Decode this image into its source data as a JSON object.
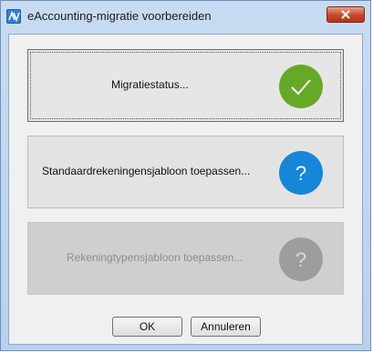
{
  "window": {
    "title": "eAccounting-migratie voorbereiden",
    "icon": "app-logo-icon",
    "close_icon": "close-icon"
  },
  "steps": [
    {
      "label": "Migratiestatus...",
      "status": "completed",
      "status_icon": "checkmark-icon",
      "status_color": "#66a926",
      "enabled": true
    },
    {
      "label": "Standaardrekeningensjabloon toepassen...",
      "status": "pending",
      "status_icon": "question-icon",
      "status_color": "#1586d8",
      "enabled": true
    },
    {
      "label": "Rekeningtypensjabloon toepassen...",
      "status": "pending",
      "status_icon": "question-icon",
      "status_color": "#9d9d9d",
      "enabled": false
    }
  ],
  "buttons": {
    "ok_label": "OK",
    "cancel_label": "Annuleren"
  }
}
